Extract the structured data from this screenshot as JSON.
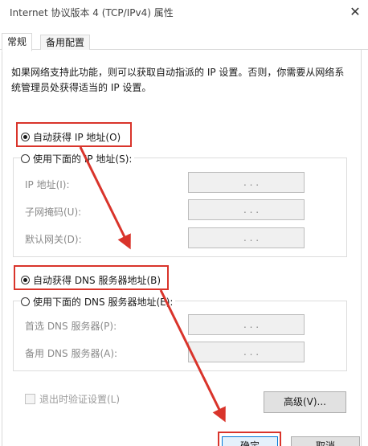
{
  "window": {
    "title": "Internet 协议版本 4 (TCP/IPv4) 属性",
    "close_glyph": "✕"
  },
  "tabs": [
    {
      "label": "常规",
      "active": true
    },
    {
      "label": "备用配置",
      "active": false
    }
  ],
  "description": "如果网络支持此功能，则可以获取自动指派的 IP 设置。否则，你需要从网络系统管理员处获得适当的 IP 设置。",
  "ip_section": {
    "auto_label": "自动获得 IP 地址(O)",
    "auto_selected": true,
    "manual_label": "使用下面的 IP 地址(S):",
    "manual_selected": false,
    "fields": [
      {
        "label": "IP 地址(I):",
        "value": ". . ."
      },
      {
        "label": "子网掩码(U):",
        "value": ". . ."
      },
      {
        "label": "默认网关(D):",
        "value": ". . ."
      }
    ]
  },
  "dns_section": {
    "auto_label": "自动获得 DNS 服务器地址(B)",
    "auto_selected": true,
    "manual_label": "使用下面的 DNS 服务器地址(E):",
    "manual_selected": false,
    "fields": [
      {
        "label": "首选 DNS 服务器(P):",
        "value": ". . ."
      },
      {
        "label": "备用 DNS 服务器(A):",
        "value": ". . ."
      }
    ]
  },
  "validate_checkbox": {
    "label": "退出时验证设置(L)",
    "checked": false
  },
  "buttons": {
    "advanced": "高级(V)...",
    "ok": "确定",
    "cancel": "取消"
  },
  "annotation_color": "#d9342b"
}
